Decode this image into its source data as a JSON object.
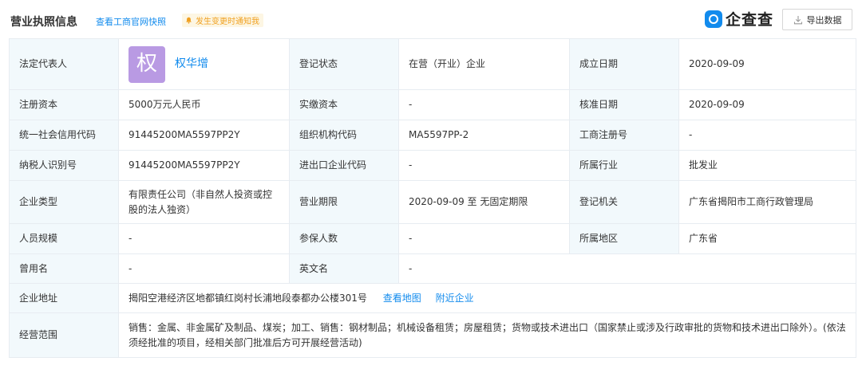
{
  "header": {
    "title": "营业执照信息",
    "snapshot_link": "查看工商官网快照",
    "notify_label": "发生变更时通知我",
    "brand_name": "企查查",
    "export_label": "导出数据"
  },
  "colors": {
    "accent": "#128bed",
    "label_bg": "#f2f9fc",
    "avatar_bg": "#b99ae3",
    "notify_bg": "#fdf6e3",
    "notify_text": "#f0a020"
  },
  "rows": {
    "r1": {
      "l1": "法定代表人",
      "avatar_char": "权",
      "legal_name": "权华增",
      "l2": "登记状态",
      "v2": "在营（开业）企业",
      "l3": "成立日期",
      "v3": "2020-09-09"
    },
    "r2": {
      "l1": "注册资本",
      "v1": "5000万元人民币",
      "l2": "实缴资本",
      "v2": "-",
      "l3": "核准日期",
      "v3": "2020-09-09"
    },
    "r3": {
      "l1": "统一社会信用代码",
      "v1": "91445200MA5597PP2Y",
      "l2": "组织机构代码",
      "v2": "MA5597PP-2",
      "l3": "工商注册号",
      "v3": "-"
    },
    "r4": {
      "l1": "纳税人识别号",
      "v1": "91445200MA5597PP2Y",
      "l2": "进出口企业代码",
      "v2": "-",
      "l3": "所属行业",
      "v3": "批发业"
    },
    "r5": {
      "l1": "企业类型",
      "v1": "有限责任公司（非自然人投资或控股的法人独资）",
      "l2": "营业期限",
      "v2": "2020-09-09 至 无固定期限",
      "l3": "登记机关",
      "v3": "广东省揭阳市工商行政管理局"
    },
    "r6": {
      "l1": "人员规模",
      "v1": "-",
      "l2": "参保人数",
      "v2": "-",
      "l3": "所属地区",
      "v3": "广东省"
    },
    "r7": {
      "l1": "曾用名",
      "v1": "-",
      "l2": "英文名",
      "v2": "-"
    },
    "r8": {
      "l1": "企业地址",
      "v1": "揭阳空港经济区地都镇红岗村长浦地段泰都办公楼301号",
      "map_link": "查看地图",
      "nearby_link": "附近企业"
    },
    "r9": {
      "l1": "经营范围",
      "v1": "销售：金属、非金属矿及制品、煤炭；加工、销售：钢材制品；机械设备租赁；房屋租赁；货物或技术进出口（国家禁止或涉及行政审批的货物和技术进出口除外）。(依法须经批准的项目，经相关部门批准后方可开展经营活动)"
    }
  }
}
